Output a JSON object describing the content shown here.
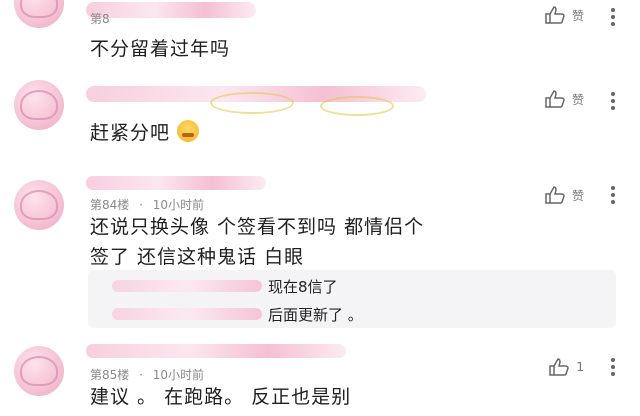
{
  "comments": [
    {
      "floor": "第8",
      "text": "不分留着过年吗",
      "like_label": "赞"
    },
    {
      "text": "赶紧分吧",
      "like_label": "赞"
    },
    {
      "floor": "第84楼",
      "time": "10小时前",
      "text_line1": "还说只换头像 个签看不到吗 都情侣个",
      "text_line2": "签了 还信这种鬼话 白眼",
      "like_label": "赞",
      "replies": [
        {
          "text": "现在8信了"
        },
        {
          "text": "后面更新了 。"
        }
      ]
    },
    {
      "floor": "第85楼",
      "time": "10小时前",
      "text": "建议 。 在跑路。 反正也是别",
      "like_count": "1"
    }
  ],
  "icons": {
    "like": "thumbs-up-icon",
    "more": "more-vertical-icon",
    "emoji": "worried-face-emoji"
  },
  "colors": {
    "meta_gray": "#8a8a8a",
    "reply_bg": "#f4f4f6",
    "blur_pink": "#f7c9dc"
  }
}
